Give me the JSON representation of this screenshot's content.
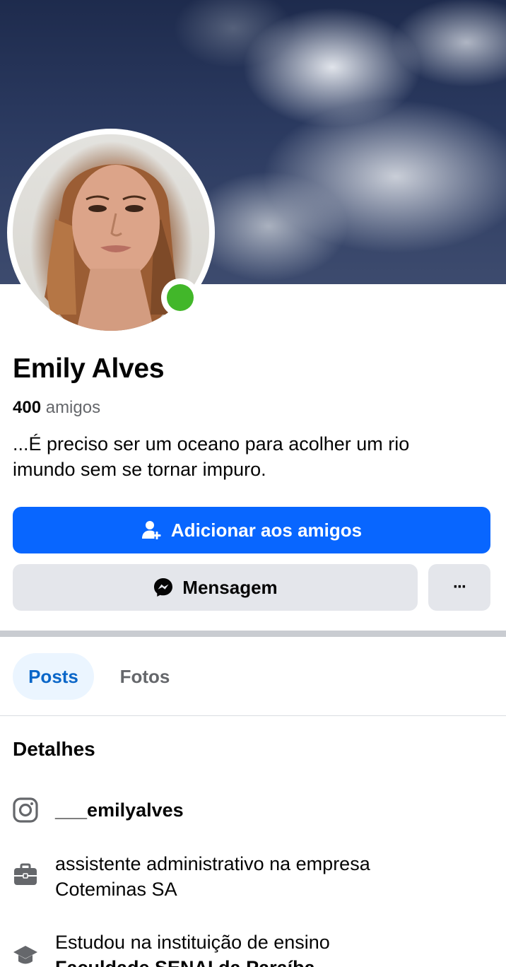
{
  "profile": {
    "name": "Emily Alves",
    "friends_count": "400",
    "friends_label": "amigos",
    "bio_line1": "...É preciso ser um oceano para acolher um rio",
    "bio_line2": "imundo sem se tornar impuro.",
    "online_status": "online"
  },
  "actions": {
    "add_friend_label": "Adicionar aos amigos",
    "message_label": "Mensagem",
    "more_label": "···"
  },
  "tabs": [
    {
      "label": "Posts",
      "selected": true
    },
    {
      "label": "Fotos",
      "selected": false
    }
  ],
  "details": {
    "title": "Detalhes",
    "instagram": "___emilyalves",
    "work_line1": "assistente administrativo na empresa",
    "work_line2": "Coteminas SA",
    "education_prefix": "Estudou na instituição de ensino",
    "education_school": "Faculdade SENAI da Paraíba"
  },
  "colors": {
    "primary": "#0866ff",
    "online": "#42b72a",
    "secondary_button": "#e4e6eb",
    "tab_selected_bg": "#ebf5ff",
    "tab_selected_text": "#0a66c8"
  },
  "icons": {
    "add_friend": "user-plus-icon",
    "message": "messenger-icon",
    "more": "more-dots-icon",
    "instagram": "instagram-icon",
    "work": "briefcase-icon",
    "education": "graduation-cap-icon"
  }
}
